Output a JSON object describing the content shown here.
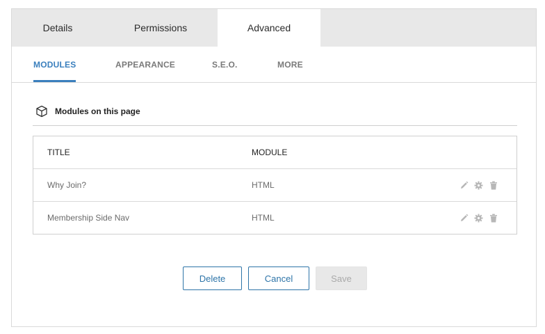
{
  "tabs": {
    "details": "Details",
    "permissions": "Permissions",
    "advanced": "Advanced"
  },
  "sub_tabs": {
    "modules": "MODULES",
    "appearance": "APPEARANCE",
    "seo": "S.E.O.",
    "more": "MORE"
  },
  "section": {
    "title": "Modules on this page",
    "icon": "cube-icon"
  },
  "table": {
    "headers": {
      "title": "TITLE",
      "module": "MODULE"
    },
    "rows": [
      {
        "title": "Why Join?",
        "module": "HTML"
      },
      {
        "title": "Membership Side Nav",
        "module": "HTML"
      }
    ],
    "row_actions": [
      "edit-icon",
      "settings-icon",
      "delete-icon"
    ]
  },
  "buttons": {
    "delete": "Delete",
    "cancel": "Cancel",
    "save": "Save"
  },
  "colors": {
    "accent": "#3a7fbd",
    "button_border": "#2d74a8",
    "tab_bar": "#e8e8e8",
    "disabled_bg": "#e8e8e8"
  }
}
